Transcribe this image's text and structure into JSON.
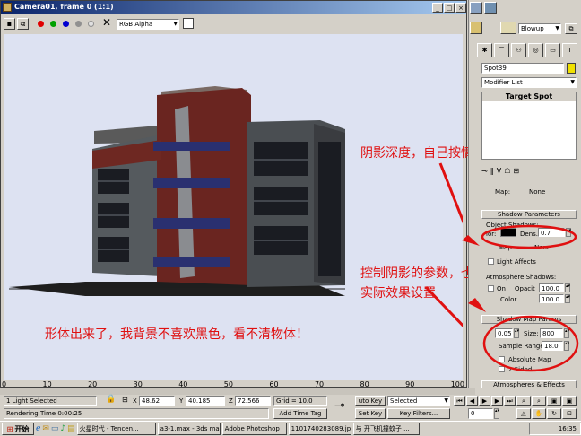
{
  "window": {
    "title": "Camera01, frame 0 (1:1)",
    "channel_select": "RGB Alpha",
    "minimize": "_",
    "maximize": "□",
    "close": "×"
  },
  "right_panel": {
    "render_type_select": "Blowup",
    "object_name": "Spot39",
    "modifier_list": "Modifier List",
    "stack_item": "Target Spot",
    "map_label": "Map:",
    "map_value": "None",
    "shadow_params_title": "Shadow Parameters",
    "object_shadows": "Object Shadows:",
    "color_label": "lor:",
    "dens_label": "Dens.",
    "dens_value": "0.7",
    "map2_label": "Map:",
    "map2_value": "None",
    "light_affects": "Light Affects",
    "atmos_shadows": "Atmosphere Shadows:",
    "on_label": "On",
    "opacity_label": "Opacit",
    "opacity_value": "100.0",
    "color2_label": "Color",
    "color2_value": "100.0",
    "shadow_map_title": "Shadow Map Params",
    "bias_value": "0.05",
    "size_label": "Size:",
    "size_value": "800",
    "sample_range_label": "Sample Range:",
    "sample_range_value": "18.0",
    "absolute_map": "Absolute Map",
    "two_sided": "2 Sided",
    "atmos_effects_title": "Atmospheres & Effects"
  },
  "annotations": {
    "note_top": "阴影深度，自己按情况设置",
    "note_mid_line1": "控制阴影的参数，也自己按",
    "note_mid_line2": "实际效果设置",
    "note_bottom": "形体出来了，我背景不喜欢黑色，看不清物体！"
  },
  "timeline": {
    "ticks": [
      "0",
      "10",
      "20",
      "30",
      "40",
      "50",
      "60",
      "70",
      "80",
      "90",
      "100"
    ]
  },
  "status": {
    "selection": "1 Light Selected",
    "x_label": "X",
    "x_value": "48.62",
    "y_label": "Y",
    "y_value": "40.185",
    "z_label": "Z",
    "z_value": "72.566",
    "grid": "Grid = 10.0",
    "rendering_time": "Rendering Time  0:00:25",
    "add_time_tag": "Add Time Tag",
    "auto_key": "uto Key",
    "selected": "Selected",
    "set_key": "Set Key",
    "key_filters": "Key Filters...",
    "frame_value": "0"
  },
  "taskbar": {
    "start": "开始",
    "items": [
      "火星时代 - Tencen...",
      "a3-1.max - 3ds ma...",
      "Adobe Photoshop",
      "1101740283089.jp...",
      "与 开飞机撞蚊子 ..."
    ],
    "clock": "16:35"
  },
  "colors": {
    "title_start": "#0a246a",
    "title_end": "#a6caf0",
    "viewport_bg": "#dde2f2",
    "annotation": "#e01010"
  }
}
